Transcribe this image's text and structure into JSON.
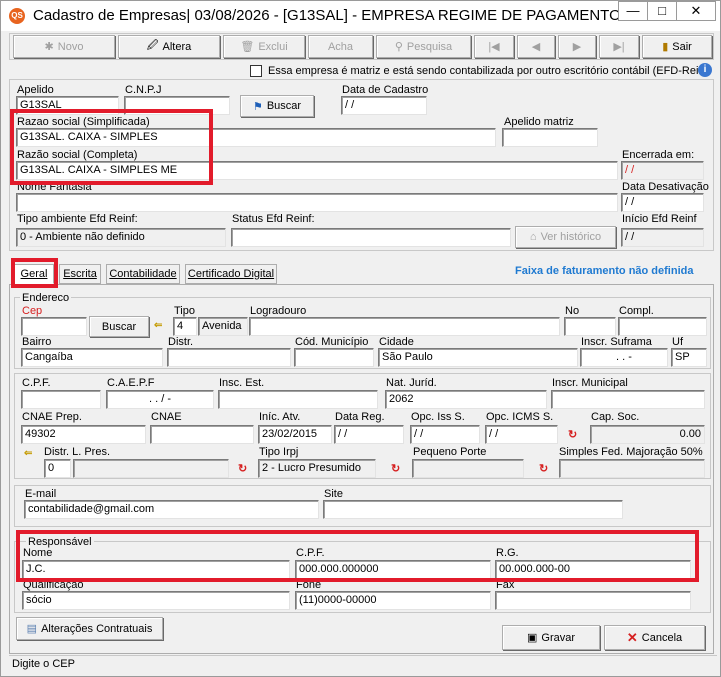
{
  "window": {
    "title": "Cadastro de Empresas|  03/08/2026 - [G13SAL] - EMPRESA REGIME DE PAGAMENTO - ...",
    "minimize": "—",
    "restore": "□",
    "close": "✕"
  },
  "toolbar": {
    "novo": "Novo",
    "altera": "Altera",
    "exclui": "Exclui",
    "acha": "Acha",
    "pesquisa": "Pesquisa",
    "sair": "Sair"
  },
  "matriz_check": "Essa empresa é matriz e está sendo contabilizada por outro escritório contábil (EFD-Reinf",
  "header": {
    "apelido_label": "Apelido",
    "apelido": "G13SAL",
    "cnpj_label": "C.N.P.J",
    "cnpj": "",
    "buscar": "Buscar",
    "data_cadastro_label": "Data de Cadastro",
    "data_cadastro": "/ /",
    "razao_simpl_label": "Razao social (Simplificada)",
    "razao_simpl": "G13SAL. CAIXA - SIMPLES",
    "apelido_matriz_label": "Apelido matriz",
    "apelido_matriz": "",
    "razao_comp_label": "Razão social (Completa)",
    "razao_comp": "G13SAL. CAIXA - SIMPLES  ME",
    "encerrada_label": "Encerrada em:",
    "encerrada": "/ /",
    "fantasia_label": "Nome Fantasia",
    "fantasia": "",
    "desativacao_label": "Data Desativação",
    "desativacao": "/ /",
    "tipo_amb_label": "Tipo ambiente Efd Reinf:",
    "tipo_amb": "0 - Ambiente não definido",
    "status_efd_label": "Status Efd Reinf:",
    "status_efd": "",
    "ver_historico": "Ver histórico",
    "inicio_efd_label": "Início Efd Reinf",
    "inicio_efd": "/ /"
  },
  "tabs": [
    "Geral",
    "Escrita",
    "Contabilidade",
    "Certificado Digital"
  ],
  "faixa": "Faixa de faturamento não definida",
  "endereco": {
    "group": "Endereco",
    "cep_label": "Cep",
    "cep": "",
    "buscar": "Buscar",
    "tipo_label": "Tipo",
    "tipo_cod": "4",
    "tipo": "Avenida",
    "logradouro_label": "Logradouro",
    "logradouro": "",
    "no_label": "No",
    "no": "",
    "compl_label": "Compl.",
    "compl": "",
    "bairro_label": "Bairro",
    "bairro": "Cangaíba",
    "distr_label": "Distr.",
    "distr": "",
    "cod_mun_label": "Cód. Município",
    "cod_mun": "",
    "cidade_label": "Cidade",
    "cidade": "São Paulo",
    "suframa_label": "Inscr. Suframa",
    "suframa": ".  .  -",
    "uf_label": "Uf",
    "uf": "SP"
  },
  "fiscal": {
    "cpf_label": "C.P.F.",
    "cpf": "",
    "caepf_label": "C.A.E.P.F",
    "caepf": ".  .  /  -",
    "insc_est_label": "Insc. Est.",
    "insc_est": "",
    "nat_jur_label": "Nat. Juríd.",
    "nat_jur": "2062",
    "insc_mun_label": "Inscr. Municipal",
    "insc_mun": "",
    "cnae_prep_label": "CNAE Prep.",
    "cnae_prep": "49302",
    "cnae_label": "CNAE",
    "cnae": "",
    "inic_atv_label": "Iníc. Atv.",
    "inic_atv": "23/02/2015",
    "data_reg_label": "Data Reg.",
    "data_reg": "/ /",
    "opc_iss_label": "Opc. Iss S.",
    "opc_iss": "/ /",
    "opc_icms_label": "Opc. ICMS S.",
    "opc_icms": "/ /",
    "cap_soc_label": "Cap. Soc.",
    "cap_soc": "0.00",
    "distr_pres_label": "Distr. L. Pres.",
    "distr_pres": "0",
    "tipo_irpj_label": "Tipo Irpj",
    "tipo_irpj": "2 - Lucro Presumido",
    "pequeno_porte_label": "Pequeno Porte",
    "pequeno_porte": "",
    "simples_maj_label": "Simples Fed. Majoração 50%",
    "simples_maj": ""
  },
  "contato": {
    "email_label": "E-mail",
    "email": "contabilidade@gmail.com",
    "site_label": "Site",
    "site": ""
  },
  "responsavel": {
    "group": "Responsável",
    "nome_label": "Nome",
    "nome": "J.C.",
    "cpf_label": "C.P.F.",
    "cpf": "000.000.000000",
    "rg_label": "R.G.",
    "rg": "00.000.000-00",
    "qualif_label": "Qualificação",
    "qualif": "sócio",
    "fone_label": "Fone",
    "fone": "(11)0000-00000",
    "fax_label": "Fax",
    "fax": ""
  },
  "bottom": {
    "alteracoes": "Alterações Contratuais",
    "gravar": "Gravar",
    "cancela": "Cancela"
  },
  "status": "Digite o CEP",
  "colors": {
    "highlight": "#e21b2b",
    "faixa": "#1f7ad1",
    "window_bg": "#f0f0f0"
  }
}
